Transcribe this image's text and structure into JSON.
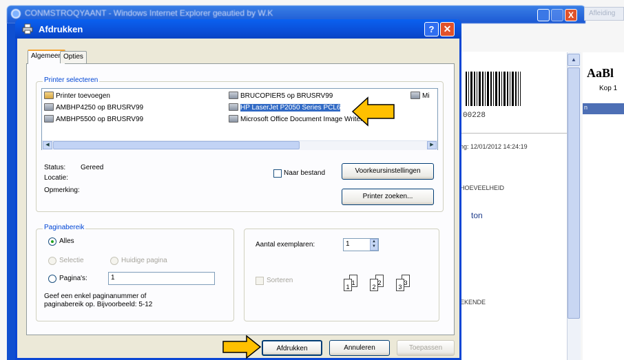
{
  "browser": {
    "title": "CONMSTROQYAANT - Windows Internet Explorer geautied by W.K",
    "tab_label": "Afleiding",
    "close_label": "X",
    "doc_number": "00228",
    "doc_date": "ng: 12/01/2012 14:24:19",
    "doc_qty_header": "HOEVEELHEID",
    "doc_unit": "ton",
    "doc_footer": "EKENDE",
    "panel_title": "AaBl",
    "panel_subtitle": "Kop 1",
    "panel_bar": "n"
  },
  "dialog": {
    "title": "Afdrukken",
    "help_label": "?",
    "close_label": "✕",
    "tabs": [
      {
        "label": "Algemeen"
      },
      {
        "label": "Opties"
      }
    ],
    "printer_group_label": "Printer selecteren",
    "printers_col1": [
      {
        "label": "Printer toevoegen",
        "icon": "add-printer-icon"
      },
      {
        "label": "AMBHP4250 op BRUSRV99",
        "icon": "printer-icon"
      },
      {
        "label": "AMBHP5500 op BRUSRV99",
        "icon": "printer-icon"
      }
    ],
    "printers_col2": [
      {
        "label": "BRUCOPIER5 op BRUSRV99",
        "icon": "printer-icon"
      },
      {
        "label": "HP LaserJet P2050 Series PCL6",
        "icon": "printer-icon",
        "selected": true
      },
      {
        "label": "Microsoft Office Document Image Writer",
        "icon": "printer-icon"
      }
    ],
    "printers_col3": [
      {
        "label": "Mi",
        "icon": "printer-icon"
      }
    ],
    "status_label": "Status:",
    "status_value": "Gereed",
    "location_label": "Locatie:",
    "comment_label": "Opmerking:",
    "to_file_label": "Naar bestand",
    "preferences_button": "Voorkeursinstellingen",
    "find_printer_button": "Printer zoeken...",
    "range_group_label": "Paginabereik",
    "range_all": "Alles",
    "range_selection": "Selectie",
    "range_current": "Huidige pagina",
    "range_pages": "Pagina's:",
    "pages_value": "1",
    "range_hint_line1": "Geef een enkel paginanummer of",
    "range_hint_line2": "paginabereik op. Bijvoorbeeld: 5-12",
    "copies_label": "Aantal exemplaren:",
    "copies_value": "1",
    "collate_label": "Sorteren",
    "collate_pages": [
      "1",
      "1",
      "2",
      "2",
      "3",
      "3"
    ],
    "print_button": "Afdrukken",
    "cancel_button": "Annuleren",
    "apply_button": "Toepassen"
  },
  "colors": {
    "title_bar": "#0a4fd8",
    "selection": "#316ac5",
    "annotation_arrow": "#ffc000"
  }
}
